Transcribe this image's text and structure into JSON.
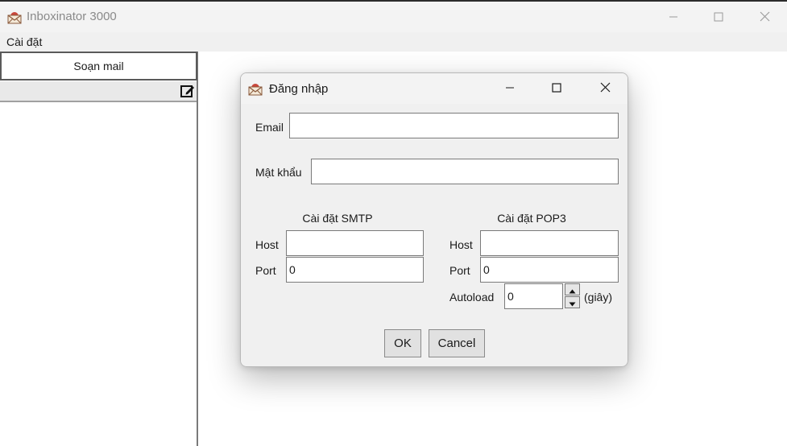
{
  "app": {
    "title": "Inboxinator 3000",
    "menu": [
      "Cài đặt"
    ],
    "compose_label": "Soạn mail",
    "accent": "#1a1a1a"
  },
  "dialog": {
    "title": "Đăng nhập",
    "email_label": "Email",
    "email_value": "",
    "password_label": "Mật khẩu",
    "password_value": "",
    "smtp": {
      "title": "Cài đặt SMTP",
      "host_label": "Host",
      "host_value": "",
      "port_label": "Port",
      "port_value": "0"
    },
    "pop3": {
      "title": "Cài đặt POP3",
      "host_label": "Host",
      "host_value": "",
      "port_label": "Port",
      "port_value": "0",
      "autoload_label": "Autoload",
      "autoload_value": "0",
      "autoload_unit": "(giây)"
    },
    "ok_label": "OK",
    "cancel_label": "Cancel"
  },
  "icons": {
    "app": "envelope-icon",
    "minimize": "minimize-icon",
    "maximize": "maximize-icon",
    "close": "close-icon",
    "edit": "edit-icon",
    "spin_up": "chevron-up-icon",
    "spin_down": "chevron-down-icon"
  }
}
